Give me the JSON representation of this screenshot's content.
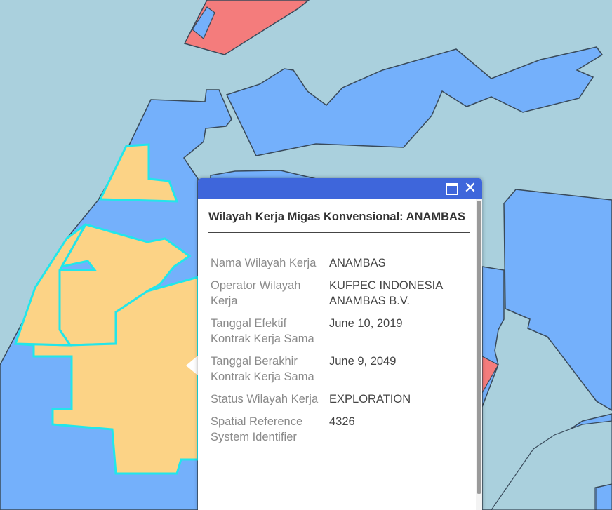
{
  "map": {
    "colors": {
      "water": "#aad0dd",
      "block_blue": "#74b0fb",
      "block_outline": "#394a5a",
      "selected_fill": "#fcd386",
      "selected_outline": "#22e6ea",
      "block_red": "#f47c7c"
    }
  },
  "popup": {
    "title": "Wilayah Kerja Migas Konvensional: ANAMBAS",
    "header_color": "#3e66db",
    "maximize_icon": "maximize-icon",
    "close_icon": "close-icon",
    "close_label": "✕",
    "fields": [
      {
        "label": "Nama Wilayah Kerja",
        "value": "ANAMBAS"
      },
      {
        "label": "Operator Wilayah Kerja",
        "value": "KUFPEC INDONESIA ANAMBAS B.V."
      },
      {
        "label": "Tanggal Efektif Kontrak Kerja Sama",
        "value": "June 10, 2019"
      },
      {
        "label": "Tanggal Berakhir Kontrak Kerja Sama",
        "value": "June 9, 2049"
      },
      {
        "label": "Status Wilayah Kerja",
        "value": "EXPLORATION"
      },
      {
        "label": "Spatial Reference System Identifier",
        "value": "4326"
      }
    ]
  }
}
